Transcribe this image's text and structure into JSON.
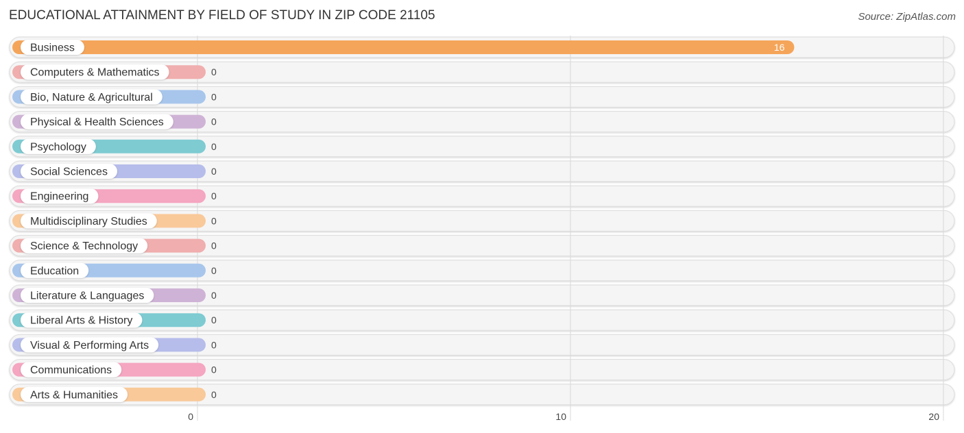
{
  "header": {
    "title": "EDUCATIONAL ATTAINMENT BY FIELD OF STUDY IN ZIP CODE 21105",
    "source": "Source: ZipAtlas.com"
  },
  "chart_data": {
    "type": "bar",
    "orientation": "horizontal",
    "title": "EDUCATIONAL ATTAINMENT BY FIELD OF STUDY IN ZIP CODE 21105",
    "xlabel": "",
    "ylabel": "",
    "xlim": [
      0,
      20
    ],
    "xticks": [
      0,
      10,
      20
    ],
    "grid": true,
    "categories": [
      "Business",
      "Computers & Mathematics",
      "Bio, Nature & Agricultural",
      "Physical & Health Sciences",
      "Psychology",
      "Social Sciences",
      "Engineering",
      "Multidisciplinary Studies",
      "Science & Technology",
      "Education",
      "Literature & Languages",
      "Liberal Arts & History",
      "Visual & Performing Arts",
      "Communications",
      "Arts & Humanities"
    ],
    "values": [
      16,
      0,
      0,
      0,
      0,
      0,
      0,
      0,
      0,
      0,
      0,
      0,
      0,
      0,
      0
    ],
    "colors": [
      "#f5a55a",
      "#f0aeae",
      "#a8c6ec",
      "#cfb3d6",
      "#7ecbd2",
      "#b6bdea",
      "#f5a6c0",
      "#f9c99a",
      "#f0aeae",
      "#a8c6ec",
      "#cfb3d6",
      "#7ecbd2",
      "#b6bdea",
      "#f5a6c0",
      "#f9c99a"
    ]
  }
}
